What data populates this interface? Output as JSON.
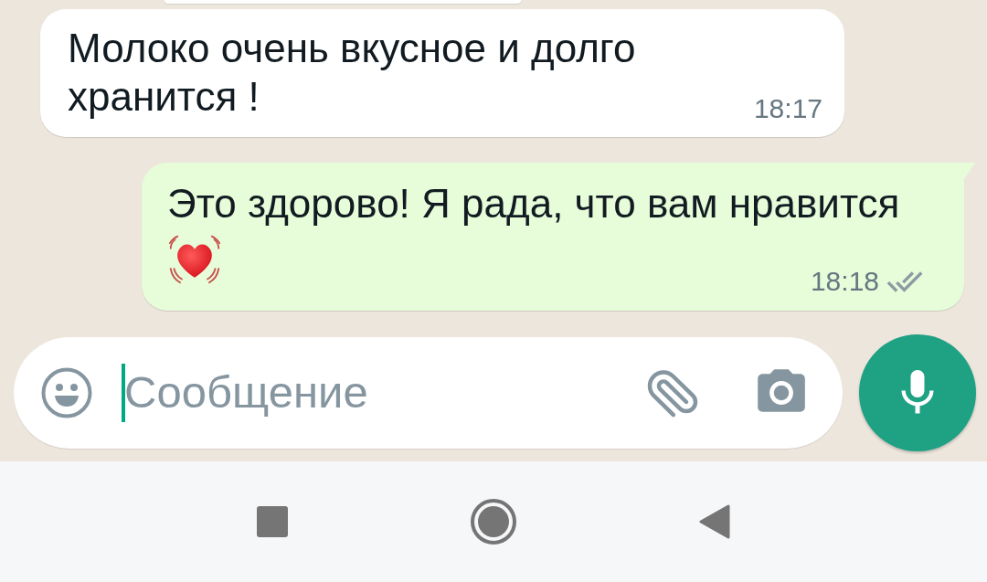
{
  "messages": [
    {
      "kind": "incoming",
      "text": "Молоко очень вкусное и долго хранится !",
      "time": "18:17"
    },
    {
      "kind": "outgoing",
      "text": "Это здорово! Я рада, что вам нравится",
      "time": "18:18",
      "read": false
    }
  ],
  "composer": {
    "placeholder": "Сообщение",
    "focused": true
  }
}
